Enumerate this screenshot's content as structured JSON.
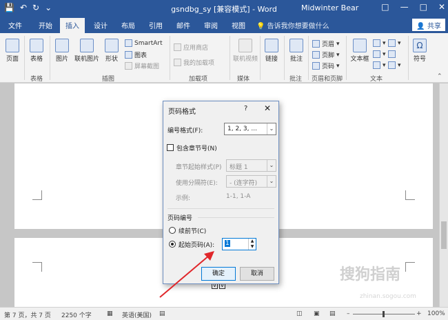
{
  "titlebar": {
    "title": "gsndbg_sy [兼容模式] - Word",
    "user": "Midwinter Bear"
  },
  "tabs": [
    "文件",
    "开始",
    "插入",
    "设计",
    "布局",
    "引用",
    "邮件",
    "审阅",
    "视图"
  ],
  "tell_me": "告诉我你想要做什么",
  "share": "共享",
  "ribbon": {
    "page": "页面",
    "table": "表格",
    "picture": "图片",
    "online_picture": "联机图片",
    "shapes": "形状",
    "smartart": "SmartArt",
    "chart": "图表",
    "screenshot": "屏幕截图",
    "store": "应用商店",
    "my_addins": "我的加载项",
    "online_video": "联机视频",
    "link": "链接",
    "comment": "批注",
    "header": "页眉",
    "footer": "页脚",
    "page_number": "页码",
    "textbox": "文本框",
    "symbol": "符号",
    "groups": {
      "table": "表格",
      "illustrations": "插图",
      "addins": "加载项",
      "media": "媒体",
      "comments": "批注",
      "header_footer": "页眉和页脚",
      "text": "文本"
    }
  },
  "dialog": {
    "title": "页码格式",
    "help": "?",
    "close": "✕",
    "format_label": "编号格式(F):",
    "format_value": "1, 2, 3, ...",
    "include_chapter": "包含章节号(N)",
    "chapter_style_label": "章节起始样式(P)",
    "chapter_style_value": "标题 1",
    "separator_label": "使用分隔符(E):",
    "separator_value": "- (连字符)",
    "example_label": "示例:",
    "example_value": "1-1, 1-A",
    "numbering_section": "页码编号",
    "continue_label": "续前节(C)",
    "start_at_label": "起始页码(A):",
    "start_at_value": "1",
    "ok": "确定",
    "cancel": "取消"
  },
  "status": {
    "page": "第 7 页，共 7 页",
    "words": "2250 个字",
    "language": "英语(美国)",
    "zoom": "100%"
  },
  "watermark": {
    "brand": "搜狗指南",
    "url": "zhinan.sogou.com"
  },
  "colors": {
    "word_blue": "#2b579a",
    "annotation_red": "#e0262a",
    "focus_blue": "#0078d7"
  }
}
